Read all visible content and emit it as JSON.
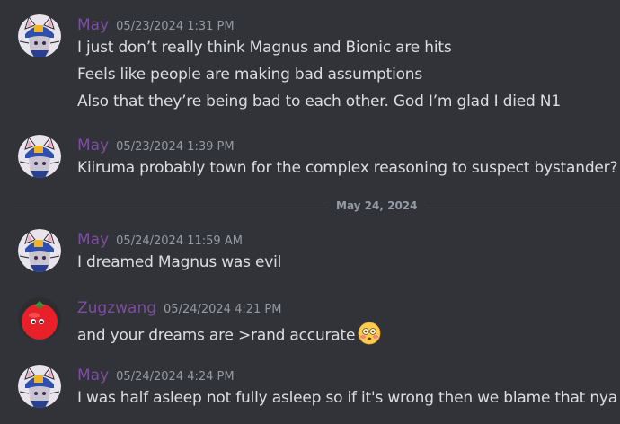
{
  "messages": [
    {
      "author": "May",
      "timestamp": "05/23/2024 1:31 PM",
      "lines": [
        "I just don’t really think Magnus and Bionic are hits",
        "Feels like people are making bad assumptions",
        "Also that they’re being bad to each other. God I’m glad I died N1"
      ]
    },
    {
      "author": "May",
      "timestamp": "05/23/2024 1:39 PM",
      "lines": [
        "Kiiruma probably town for the complex reasoning to suspect bystander?"
      ]
    },
    {
      "author": "May",
      "timestamp": "05/24/2024 11:59 AM",
      "lines": [
        "I dreamed Magnus was evil"
      ]
    },
    {
      "author": "Zugzwang",
      "timestamp": "05/24/2024 4:21 PM",
      "lines": [
        "and your dreams are >rand accurate"
      ]
    },
    {
      "author": "May",
      "timestamp": "05/24/2024 4:24 PM",
      "lines": [
        "I was half asleep not fully asleep so if it's wrong then we blame that nya"
      ]
    }
  ],
  "date_divider": "May 24, 2024",
  "colors": {
    "background": "#313338",
    "author_name": "#7c4e9f",
    "message_text": "#dbdee1",
    "timestamp": "#949ba4"
  },
  "icons": {
    "may_avatar": "anime-cat-girl-avatar-icon",
    "zugzwang_avatar": "tomato-face-avatar-icon",
    "reaction_emoji": "flushed-face-emoji-icon"
  }
}
